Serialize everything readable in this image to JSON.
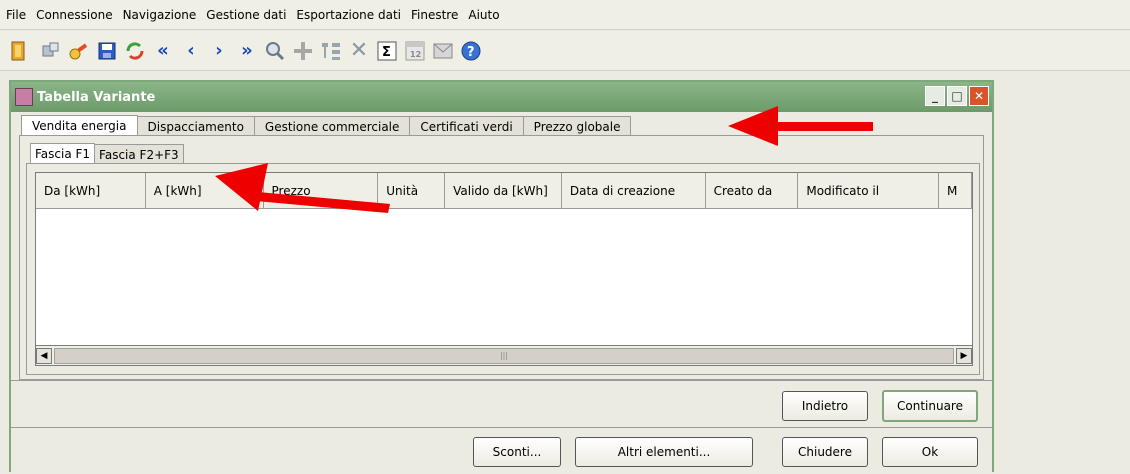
{
  "menu": [
    "File",
    "Connessione",
    "Navigazione",
    "Gestione dati",
    "Esportazione dati",
    "Finestre",
    "Aiuto"
  ],
  "toolbar": {
    "icons": [
      "exit-icon",
      "plugin-icon",
      "key-icon",
      "save-icon",
      "refresh-icon",
      "first-icon",
      "previous-icon",
      "next-icon",
      "last-icon",
      "search-icon",
      "add-icon",
      "tree-icon",
      "delete-icon",
      "sum-icon",
      "calendar-icon",
      "mail-icon",
      "help-icon"
    ]
  },
  "window": {
    "title": "Tabella Variante"
  },
  "tabs": [
    "Vendita energia",
    "Dispacciamento",
    "Gestione commerciale",
    "Certificati verdi",
    "Prezzo globale"
  ],
  "subtabs": [
    "Fascia F1",
    "Fascia F2+F3"
  ],
  "table": {
    "columns": [
      "Da [kWh]",
      "A [kWh]",
      "Prezzo",
      "Unità",
      "Valido da [kWh]",
      "Data di creazione",
      "Creato da",
      "Modificato il",
      "M"
    ]
  },
  "nav_buttons": {
    "back": "Indietro",
    "next": "Continuare"
  },
  "action_buttons": {
    "discounts": "Sconti...",
    "other": "Altri elementi...",
    "close": "Chiudere",
    "ok": "Ok"
  },
  "colors": {
    "frame_title": "#7aa877",
    "arrow": "#ee0000",
    "close_button": "#d9542a"
  }
}
